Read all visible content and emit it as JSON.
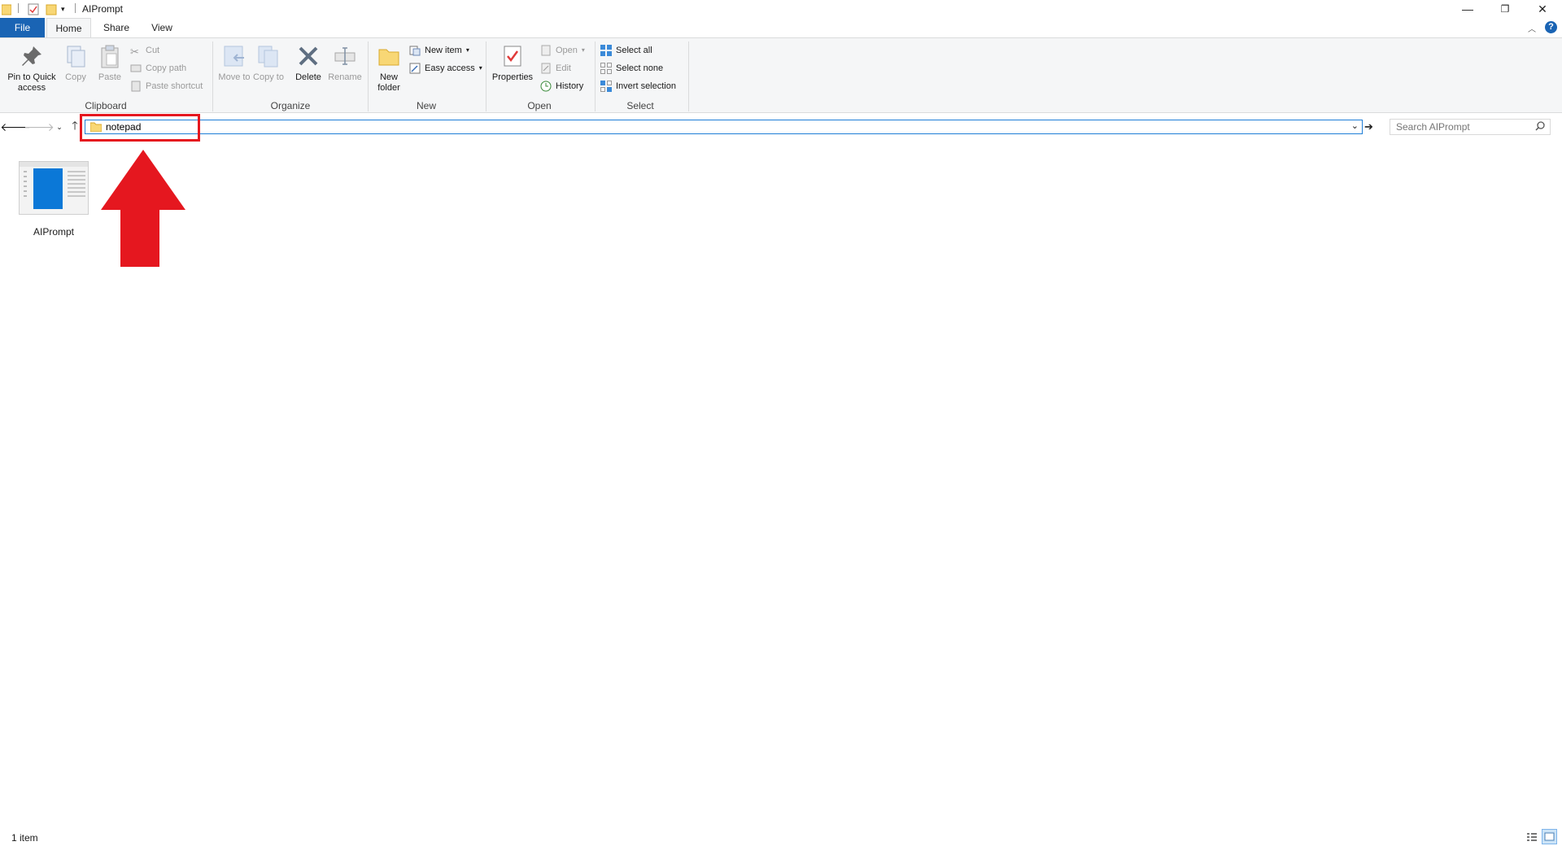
{
  "window": {
    "title": "AIPrompt",
    "minimize": "—",
    "restore": "❐",
    "close": "✕"
  },
  "ribbon_tabs": {
    "file": "File",
    "home": "Home",
    "share": "Share",
    "view": "View"
  },
  "clipboard": {
    "group_label": "Clipboard",
    "pin": "Pin to Quick access",
    "copy": "Copy",
    "paste": "Paste",
    "cut": "Cut",
    "copy_path": "Copy path",
    "paste_shortcut": "Paste shortcut"
  },
  "organize": {
    "group_label": "Organize",
    "move_to": "Move to",
    "copy_to": "Copy to",
    "delete": "Delete",
    "rename": "Rename"
  },
  "new": {
    "group_label": "New",
    "new_folder": "New folder",
    "new_item": "New item",
    "easy_access": "Easy access"
  },
  "open": {
    "group_label": "Open",
    "properties": "Properties",
    "open": "Open",
    "edit": "Edit",
    "history": "History"
  },
  "select": {
    "group_label": "Select",
    "select_all": "Select all",
    "select_none": "Select none",
    "invert_selection": "Invert selection"
  },
  "address_bar": {
    "value": "notepad"
  },
  "search": {
    "placeholder": "Search AIPrompt"
  },
  "files": [
    {
      "name": "AIPrompt",
      "icon": "document-thumbnail-icon"
    }
  ],
  "status": {
    "item_count": "1 item"
  },
  "colors": {
    "file_tab": "#1a64b4",
    "address_focus": "#1f7ed7",
    "annotation_red": "#e5171f",
    "ribbon_bg": "#f5f6f7"
  }
}
